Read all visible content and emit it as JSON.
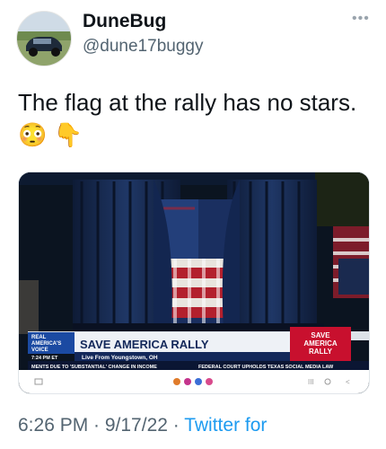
{
  "user": {
    "display_name": "DuneBug",
    "handle": "@dune17buggy"
  },
  "tweet": {
    "text": "The flag at the rally has no stars. 😳 👇"
  },
  "broadcast": {
    "network_logo": "REAL AMERICA'S VOICE",
    "network_logo_line1": "REAL",
    "network_logo_line2": "AMERICA'S",
    "network_logo_line3": "VOICE",
    "headline": "SAVE AMERICA RALLY",
    "time": "7:24 PM ET",
    "subhead": "Live From Youngstown, OH",
    "ticker_left": "MENTS DUE TO 'SUBSTANTIAL' CHANGE IN INCOME",
    "ticker_right": "FEDERAL COURT UPHOLDS TEXAS SOCIAL MEDIA LAW",
    "badge_line1": "SAVE",
    "badge_line2": "AMERICA",
    "badge_line3": "RALLY"
  },
  "footer": {
    "time": "6:26 PM · 9/17/22 · ",
    "source": "Twitter for"
  },
  "icons": {
    "more": "more-options-icon",
    "avatar": "avatar-car-photo"
  },
  "colors": {
    "handle": "#536471",
    "link": "#1d9bf0",
    "curtain": "#16284d",
    "lower_third": "#13285a",
    "badge_red": "#c8102e"
  }
}
